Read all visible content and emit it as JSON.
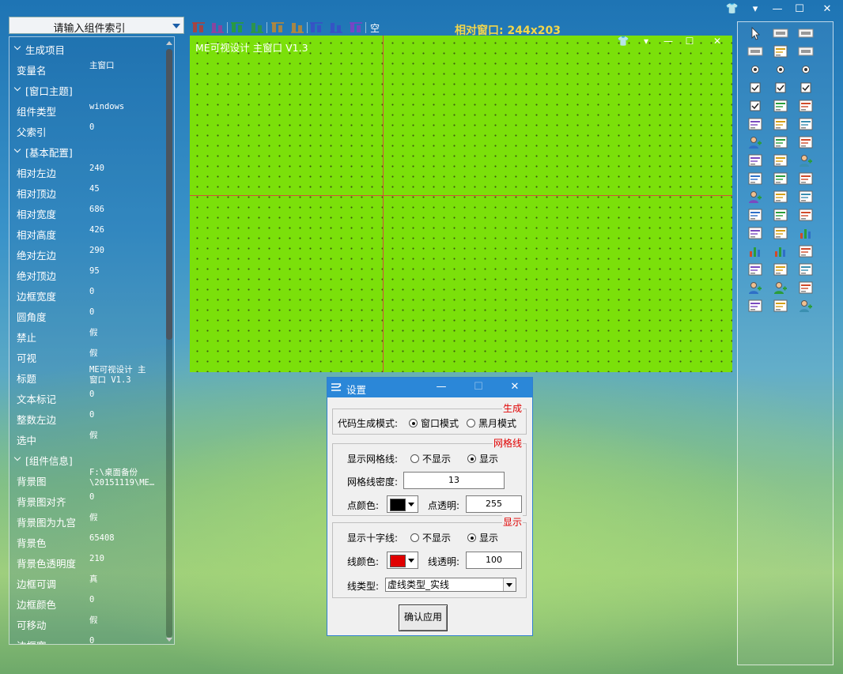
{
  "window_controls": {
    "skin": "👕",
    "menu": "▾",
    "minimize": "—",
    "maximize": "☐",
    "close": "✕"
  },
  "left_panel": {
    "search_placeholder": "请输入组件索引",
    "properties": [
      {
        "type": "section",
        "key": "生成项目"
      },
      {
        "type": "prop",
        "key": "变量名",
        "value": "主窗口"
      },
      {
        "type": "section",
        "key": "[窗口主题]"
      },
      {
        "type": "prop",
        "key": "组件类型",
        "value": "windows"
      },
      {
        "type": "prop",
        "key": "父索引",
        "value": "0"
      },
      {
        "type": "section",
        "key": "[基本配置]"
      },
      {
        "type": "prop",
        "key": "相对左边",
        "value": "240"
      },
      {
        "type": "prop",
        "key": "相对顶边",
        "value": "45"
      },
      {
        "type": "prop",
        "key": "相对宽度",
        "value": "686"
      },
      {
        "type": "prop",
        "key": "相对高度",
        "value": "426"
      },
      {
        "type": "prop",
        "key": "绝对左边",
        "value": "290"
      },
      {
        "type": "prop",
        "key": "绝对顶边",
        "value": "95"
      },
      {
        "type": "prop",
        "key": "边框宽度",
        "value": "0"
      },
      {
        "type": "prop",
        "key": "圆角度",
        "value": "0"
      },
      {
        "type": "prop",
        "key": "禁止",
        "value": "假"
      },
      {
        "type": "prop",
        "key": "可视",
        "value": "假"
      },
      {
        "type": "prop",
        "key": "标题",
        "value": "ME可视设计 主\n窗口 V1.3"
      },
      {
        "type": "prop",
        "key": "文本标记",
        "value": "0"
      },
      {
        "type": "prop",
        "key": "整数左边",
        "value": "0"
      },
      {
        "type": "prop",
        "key": "选中",
        "value": "假"
      },
      {
        "type": "section",
        "key": "[组件信息]"
      },
      {
        "type": "prop",
        "key": "背景图",
        "value": "F:\\桌面备份\n\\20151119\\ME…"
      },
      {
        "type": "prop",
        "key": "背景图对齐",
        "value": "0"
      },
      {
        "type": "prop",
        "key": "背景图为九宫",
        "value": "假"
      },
      {
        "type": "prop",
        "key": "背景色",
        "value": "65408"
      },
      {
        "type": "prop",
        "key": "背景色透明度",
        "value": "210"
      },
      {
        "type": "prop",
        "key": "边框可调",
        "value": "真"
      },
      {
        "type": "prop",
        "key": "边框颜色",
        "value": "0"
      },
      {
        "type": "prop",
        "key": "可移动",
        "value": "假"
      },
      {
        "type": "prop",
        "key": "边框宽",
        "value": "0"
      }
    ]
  },
  "toolbar": {
    "relative_window": "相对窗口: 244x203",
    "icons": [
      "align-left-icon",
      "align-right-icon",
      "align-top-icon",
      "align-bottom-icon",
      "same-width-icon",
      "same-height-icon",
      "hcenter-icon",
      "vcenter-icon",
      "distribute-icon",
      "space-icon"
    ],
    "space_label": "空"
  },
  "canvas": {
    "title": "ME可视设计 主窗口 V1.3",
    "controls": {
      "skin": "👕",
      "menu": "▾",
      "minimize": "—",
      "maximize": "☐",
      "close": "✕"
    },
    "background": "#7be00a",
    "crosshair": "#d2503a"
  },
  "palette_icons": [
    "pointer-icon",
    "label-icon",
    "label-bold-icon",
    "label-small-icon",
    "font-icon",
    "edit-icon",
    "radio-icon",
    "radio2-icon",
    "radio3-icon",
    "checkbox-icon",
    "checkbox2-icon",
    "checkbox3-icon",
    "checkbox4-icon",
    "text-icon",
    "arrow-tool-icon",
    "picture-icon",
    "progress-icon",
    "slider-icon",
    "user-icon",
    "spin-icon",
    "tab-scroll-icon",
    "list-icon",
    "combo-icon",
    "user2-icon",
    "shape-icon",
    "folder-icon",
    "tree-icon",
    "user3-icon",
    "grid-icon",
    "camera-icon",
    "link-icon",
    "table-icon",
    "list2-icon",
    "book-icon",
    "calendar-icon",
    "bar-chart-icon",
    "line-chart-icon",
    "pie-chart-icon",
    "list3-icon",
    "window-icon",
    "frame-icon",
    "resize-icon",
    "user4-icon",
    "user5-icon",
    "pen-icon",
    "image-icon",
    "flag-icon",
    "user6-icon"
  ],
  "dialog": {
    "title": "设置",
    "controls": {
      "minimize": "—",
      "maximize": "☐",
      "close": "✕"
    },
    "group_generate": {
      "caption": "生成",
      "mode_label": "代码生成模式:",
      "window_mode": "窗口模式",
      "dark_mode": "黑月模式",
      "selected": "window"
    },
    "group_grid": {
      "caption": "网格线",
      "show_grid_label": "显示网格线:",
      "hide": "不显示",
      "show": "显示",
      "selected": "show",
      "density_label": "网格线密度:",
      "density_value": "13",
      "dot_color_label": "点颜色:",
      "dot_color": "#000000",
      "dot_alpha_label": "点透明:",
      "dot_alpha_value": "255"
    },
    "group_display": {
      "caption": "显示",
      "show_cross_label": "显示十字线:",
      "hide": "不显示",
      "show": "显示",
      "selected": "show",
      "line_color_label": "线颜色:",
      "line_color": "#e00000",
      "line_alpha_label": "线透明:",
      "line_alpha_value": "100",
      "line_type_label": "线类型:",
      "line_type_value": "虚线类型_实线"
    },
    "apply_button": "确认应用"
  }
}
